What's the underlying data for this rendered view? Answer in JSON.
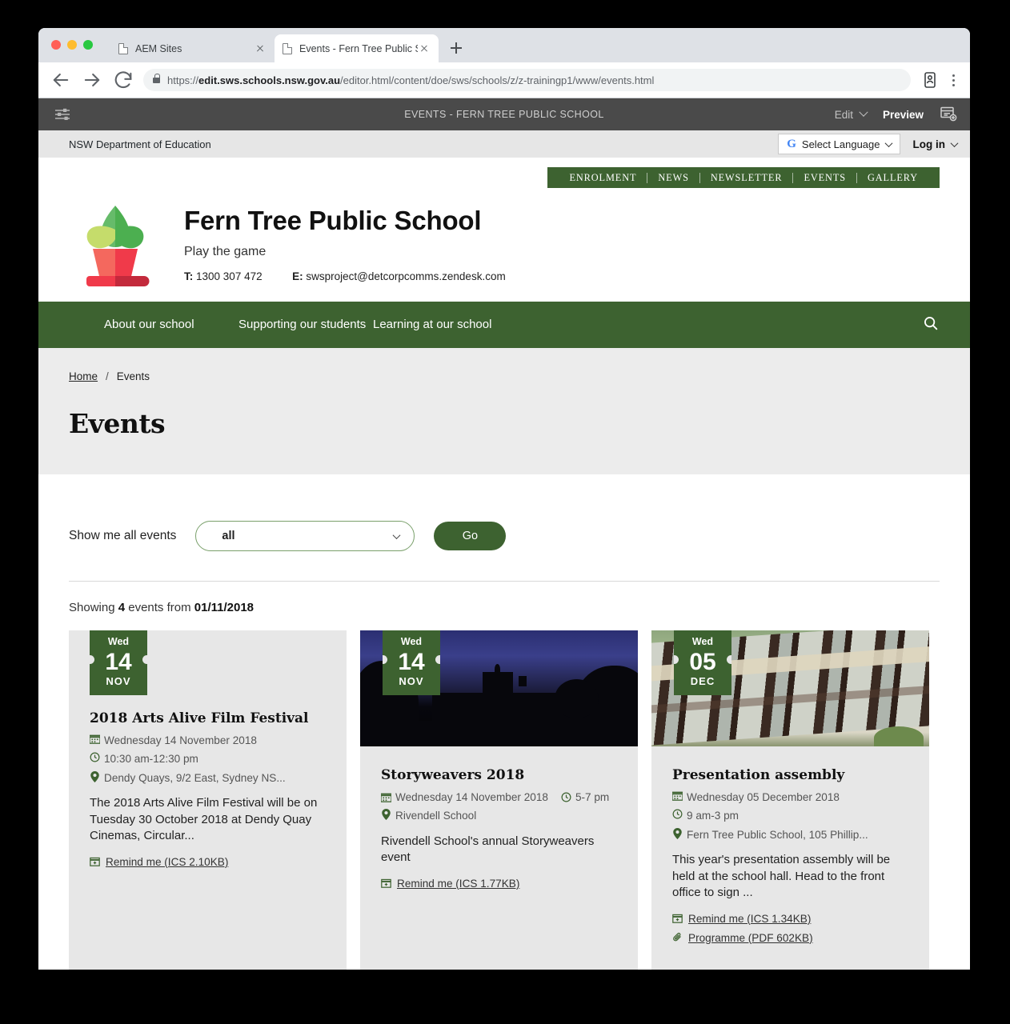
{
  "browser": {
    "tabs": [
      {
        "title": "AEM Sites",
        "active": false
      },
      {
        "title": "Events - Fern Tree Public Scho",
        "active": true
      }
    ],
    "new_tab_label": "+",
    "url": {
      "scheme": "https://",
      "domain": "edit.sws.schools.nsw.gov.au",
      "path": "/editor.html/content/doe/sws/schools/z/z-trainingp1/www/events.html"
    },
    "icons": {
      "back": "back-arrow-icon",
      "forward": "forward-arrow-icon",
      "reload": "reload-icon",
      "lock": "lock-icon",
      "profile": "profile-icon",
      "menu": "kebab-menu-icon"
    }
  },
  "aem_toolbar": {
    "sidebar_toggle": "layers-toggle-icon",
    "title": "EVENTS - FERN TREE PUBLIC SCHOOL",
    "edit_label": "Edit",
    "preview_label": "Preview",
    "page_info_icon": "page-properties-icon"
  },
  "dept_bar": {
    "department": "NSW Department of Education",
    "language_select": "Select Language",
    "login_label": "Log in"
  },
  "util_nav": {
    "items": [
      "ENROLMENT",
      "NEWS",
      "NEWSLETTER",
      "EVENTS",
      "GALLERY"
    ]
  },
  "branding": {
    "logo_name": "plant-in-pot-logo",
    "school_name": "Fern Tree Public School",
    "tagline": "Play the game",
    "phone_label": "T:",
    "phone": "1300 307 472",
    "email_label": "E:",
    "email": "swsproject@detcorpcomms.zendesk.com"
  },
  "main_nav": {
    "items": [
      "About our school",
      "Supporting our students",
      "Learning at our school"
    ],
    "search_icon": "search-icon"
  },
  "breadcrumb": {
    "home": "Home",
    "separator": "/",
    "current": "Events"
  },
  "hero": {
    "title": "Events"
  },
  "filter": {
    "label": "Show me all events",
    "selected": "all",
    "go_label": "Go"
  },
  "results": {
    "prefix": "Showing",
    "count": "4",
    "middle": "events from",
    "date": "01/11/2018"
  },
  "events": [
    {
      "badge": {
        "dow": "Wed",
        "day": "14",
        "month": "NOV"
      },
      "has_image": false,
      "title": "2018 Arts Alive Film Festival",
      "date": "Wednesday 14 November 2018",
      "time": "10:30 am-12:30 pm",
      "location": "Dendy Quays, 9/2 East, Sydney NS...",
      "description": "The 2018 Arts Alive Film Festival will be on Tuesday 30 October 2018 at Dendy Quay Cinemas, Circular...",
      "attachments": [
        {
          "icon": "calendar-add-icon",
          "label": "Remind me (ICS 2.10KB)"
        }
      ]
    },
    {
      "badge": {
        "dow": "Wed",
        "day": "14",
        "month": "NOV"
      },
      "has_image": true,
      "image_name": "rivendell-school-dusk-photo",
      "title": "Storyweavers 2018",
      "date": "Wednesday 14 November 2018",
      "time": "5-7 pm",
      "location": "Rivendell School",
      "description": "Rivendell School's annual Storyweavers event",
      "attachments": [
        {
          "icon": "calendar-add-icon",
          "label": "Remind me (ICS 1.77KB)"
        }
      ]
    },
    {
      "badge": {
        "dow": "Wed",
        "day": "05",
        "month": "DEC"
      },
      "has_image": true,
      "image_name": "school-building-photo",
      "title": "Presentation assembly",
      "date": "Wednesday 05 December 2018",
      "time": "9 am-3 pm",
      "location": "Fern Tree Public School, 105 Phillip...",
      "description": "This year's presentation assembly will be held at the school hall. Head to the front office to sign ...",
      "attachments": [
        {
          "icon": "calendar-add-icon",
          "label": "Remind me (ICS 1.34KB)"
        },
        {
          "icon": "paperclip-icon",
          "label": "Programme (PDF 602KB)"
        }
      ]
    }
  ],
  "colors": {
    "brand_green": "#3d6230",
    "card_bg": "#e7e7e7",
    "hero_bg": "#ececec",
    "aem_bar": "#4a4a4a"
  }
}
